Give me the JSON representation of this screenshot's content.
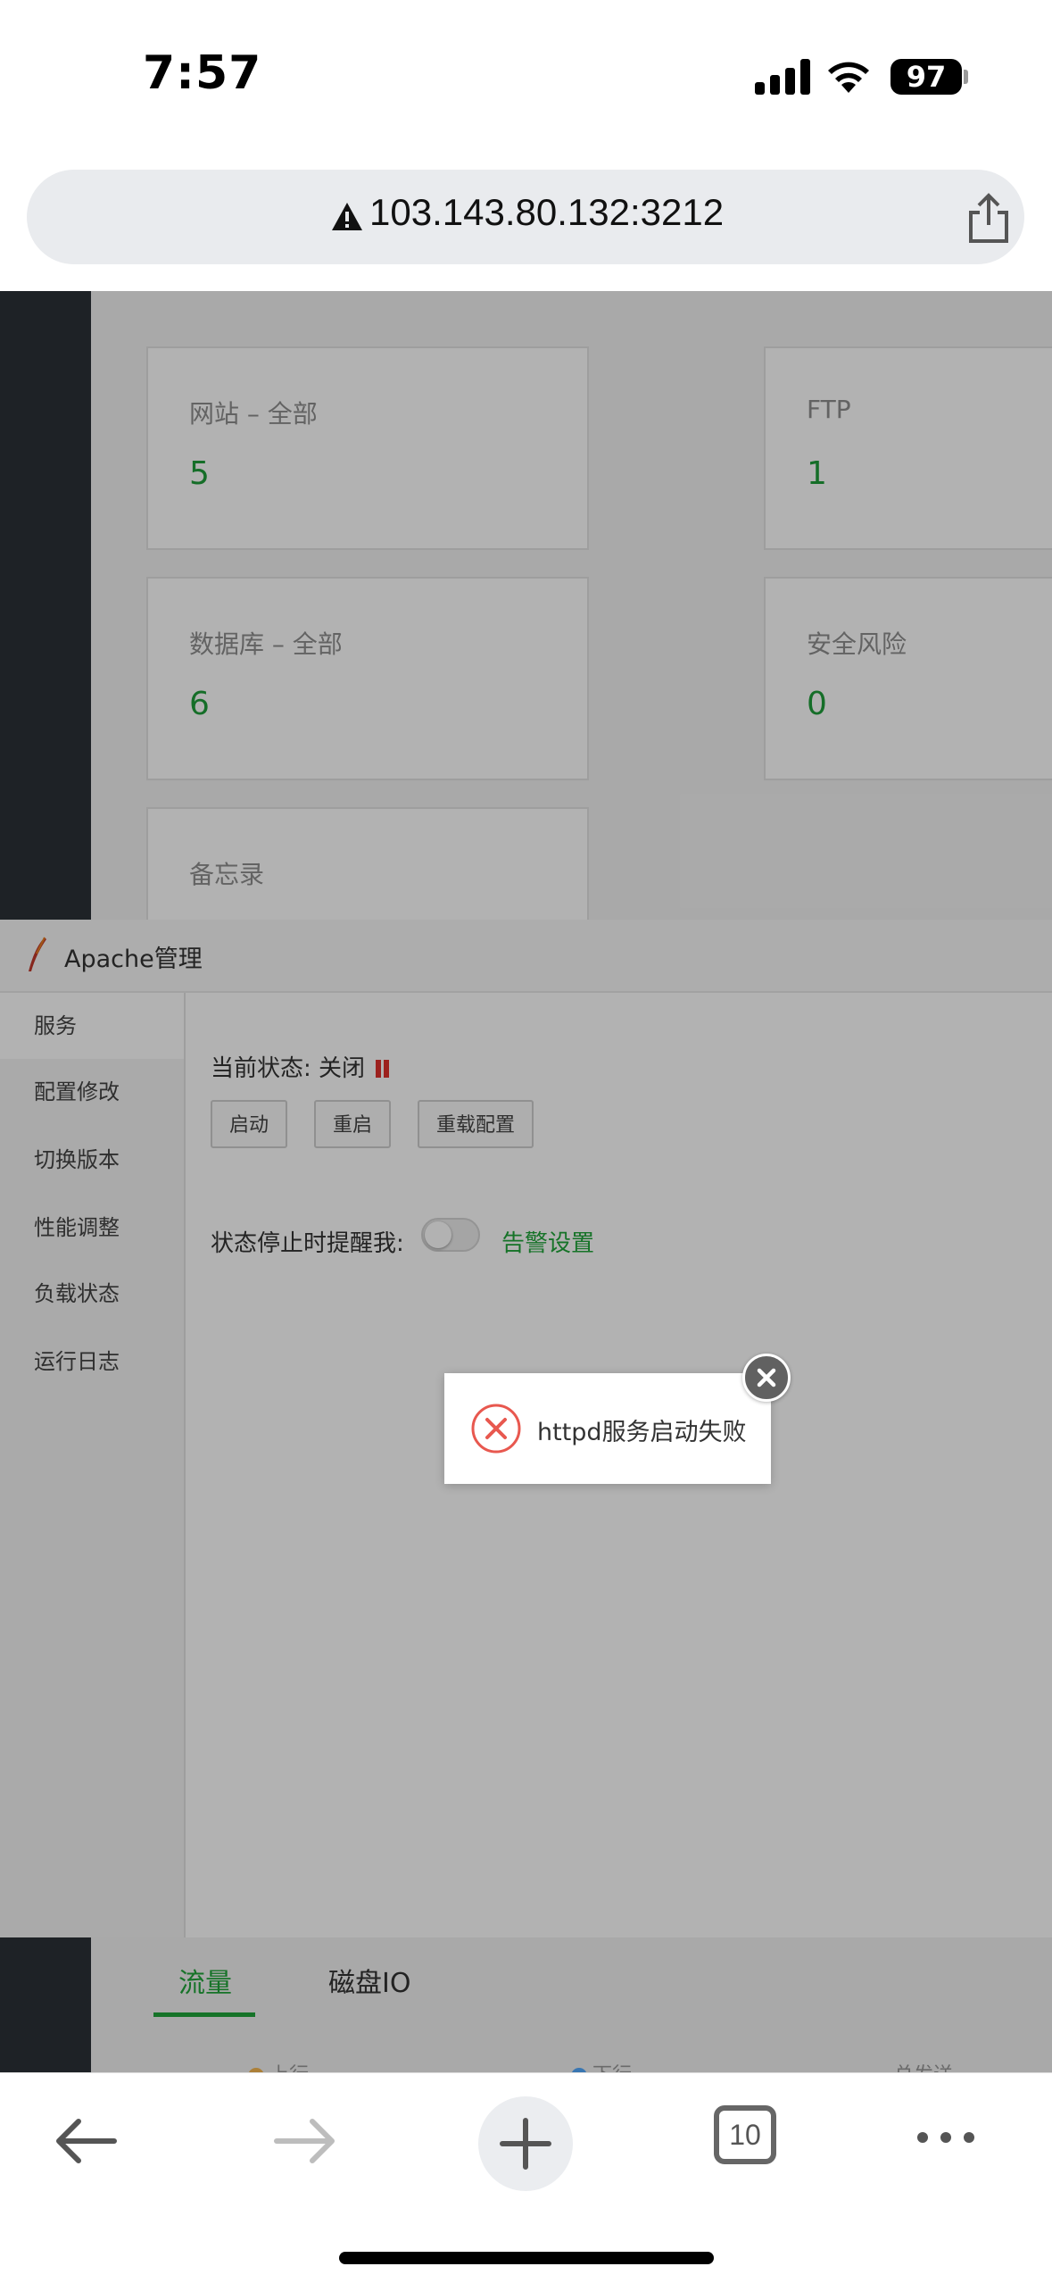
{
  "status_bar": {
    "time": "7:57",
    "battery": "97"
  },
  "browser": {
    "url": "103.143.80.132:3212",
    "tab_count": "10"
  },
  "dashboard": {
    "cards": [
      {
        "label": "网站 – 全部",
        "value": "5"
      },
      {
        "label": "FTP",
        "value": "1"
      },
      {
        "label": "数据库 – 全部",
        "value": "6"
      },
      {
        "label": "安全风险",
        "value": "0"
      },
      {
        "label": "备忘录",
        "value": ""
      }
    ],
    "tabs": [
      "流量",
      "磁盘IO"
    ],
    "legend": [
      "上行",
      "下行",
      "总发送"
    ]
  },
  "modal": {
    "title": "Apache管理",
    "sidebar": [
      "服务",
      "配置修改",
      "切换版本",
      "性能调整",
      "负载状态",
      "运行日志"
    ],
    "status_label": "当前状态:",
    "status_value": "关闭",
    "buttons": [
      "启动",
      "重启",
      "重载配置"
    ],
    "remind_label": "状态停止时提醒我:",
    "alert_link": "告警设置"
  },
  "toast": {
    "message": "httpd服务启动失败"
  },
  "colors": {
    "accent": "#20a53a",
    "error": "#e0302b"
  }
}
